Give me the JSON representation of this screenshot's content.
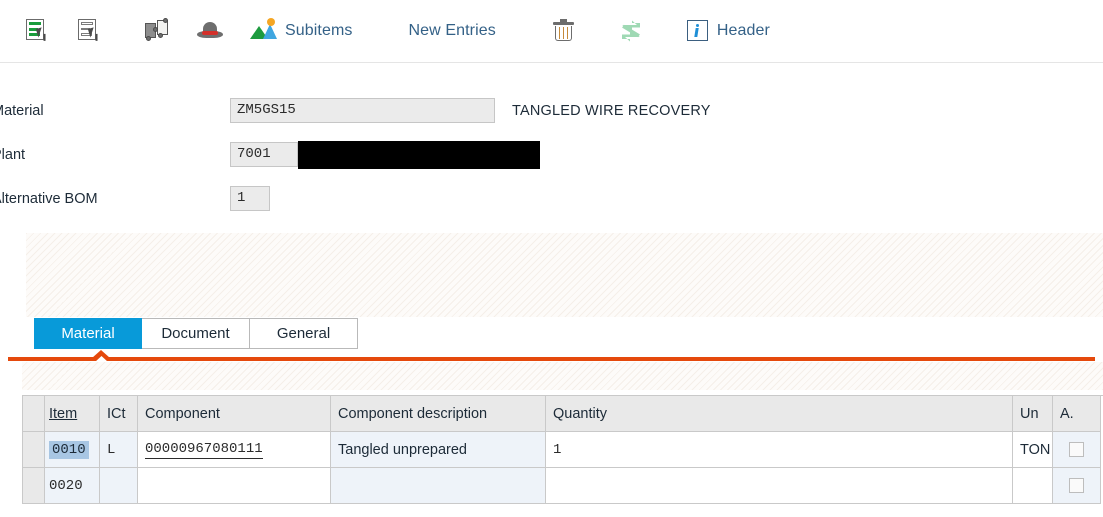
{
  "toolbar": {
    "buttons": [
      {
        "name": "select-all-rows-icon",
        "label": "",
        "icon": "list-select-filled-icon"
      },
      {
        "name": "deselect-all-rows-icon",
        "label": "",
        "icon": "list-select-outline-icon"
      },
      {
        "name": "component-assignment-icon",
        "label": "",
        "icon": "puzzle-icon"
      },
      {
        "name": "long-text-icon",
        "label": "",
        "icon": "hat-icon"
      },
      {
        "name": "subitems-button",
        "label": "Subitems",
        "icon": "mountains-sun-icon"
      },
      {
        "name": "new-entries-button",
        "label": "New Entries",
        "icon": ""
      },
      {
        "name": "delete-button",
        "label": "",
        "icon": "trash-icon"
      },
      {
        "name": "swap-button",
        "label": "",
        "icon": "swap-arrows-icon"
      },
      {
        "name": "header-button",
        "label": "Header",
        "icon": "info-icon"
      }
    ],
    "subitems_label": "Subitems",
    "new_entries_label": "New Entries",
    "header_label": "Header"
  },
  "header_fields": {
    "material": {
      "label": "Material",
      "value": "ZM5GS15",
      "description": "TANGLED WIRE RECOVERY"
    },
    "plant": {
      "label": "Plant",
      "value": "7001",
      "description_redacted": true
    },
    "alternative_bom": {
      "label": "Alternative BOM",
      "value": "1"
    }
  },
  "tabs": {
    "items": [
      {
        "label": "Material",
        "active": true
      },
      {
        "label": "Document",
        "active": false
      },
      {
        "label": "General",
        "active": false
      }
    ],
    "active_index": 0,
    "accent_color": "#089ad9",
    "underline_color": "#e5490c"
  },
  "grid": {
    "columns": [
      {
        "key": "sel",
        "label": "",
        "sorted": false
      },
      {
        "key": "item",
        "label": "Item",
        "sorted": true
      },
      {
        "key": "ict",
        "label": "ICt",
        "sorted": false
      },
      {
        "key": "comp",
        "label": "Component",
        "sorted": false
      },
      {
        "key": "desc",
        "label": "Component description",
        "sorted": false
      },
      {
        "key": "qty",
        "label": "Quantity",
        "sorted": false
      },
      {
        "key": "un",
        "label": "Un",
        "sorted": false
      },
      {
        "key": "a",
        "label": "A.",
        "sorted": false
      }
    ],
    "rows": [
      {
        "item": "0010",
        "ict": "L",
        "component": "00000967080111",
        "description": "Tangled unprepared",
        "quantity": "1",
        "unit": "TON",
        "a_checked": false,
        "selected": true
      },
      {
        "item": "0020",
        "ict": "",
        "component": "",
        "description": "",
        "quantity": "",
        "unit": "",
        "a_checked": false,
        "selected": false
      }
    ]
  }
}
